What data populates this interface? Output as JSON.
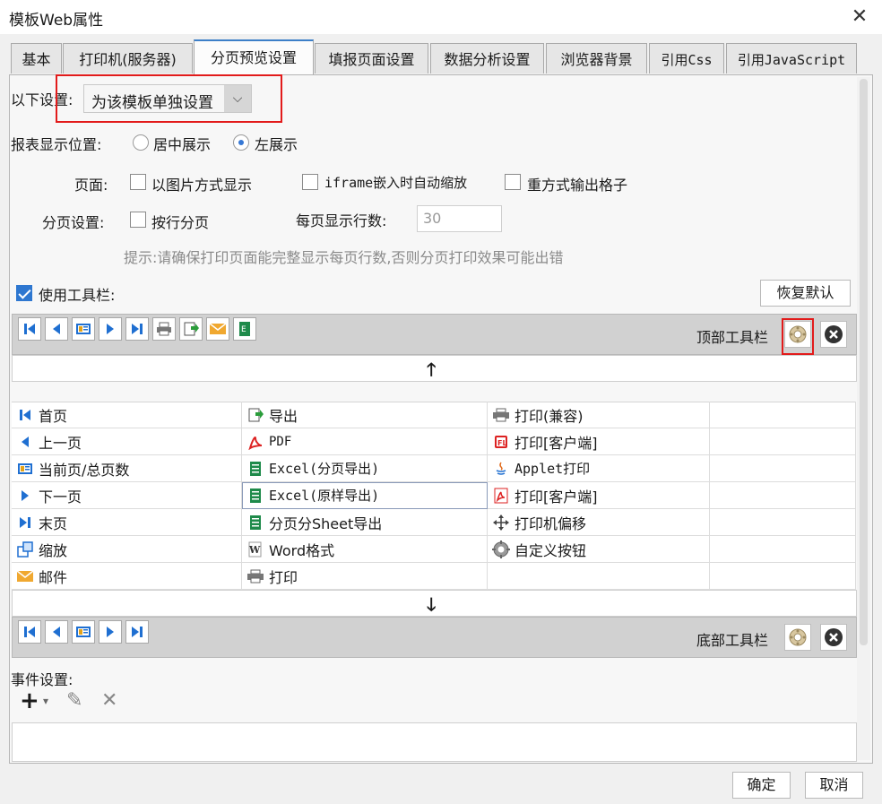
{
  "window": {
    "title": "模板Web属性",
    "close_glyph": "✕"
  },
  "tabs": [
    {
      "label": "基本",
      "active": false
    },
    {
      "label": "打印机(服务器)",
      "active": false
    },
    {
      "label": "分页预览设置",
      "active": true
    },
    {
      "label": "填报页面设置",
      "active": false
    },
    {
      "label": "数据分析设置",
      "active": false
    },
    {
      "label": "浏览器背景",
      "active": false
    },
    {
      "label": "引用Css",
      "active": false
    },
    {
      "label": "引用JavaScript",
      "active": false
    }
  ],
  "settings": {
    "label": "以下设置:",
    "value": "为该模板单独设置",
    "arrow_glyph": "⌵"
  },
  "position": {
    "label": "报表显示位置:",
    "options": [
      {
        "label": "居中展示",
        "selected": false
      },
      {
        "label": "左展示",
        "selected": true
      }
    ]
  },
  "page": {
    "label": "页面:",
    "options": [
      {
        "label": "以图片方式显示",
        "checked": false
      },
      {
        "label": "iframe嵌入时自动缩放",
        "checked": false
      },
      {
        "label": "重方式输出格子",
        "checked": false
      }
    ]
  },
  "pagination": {
    "label": "分页设置:",
    "by_row_label": "按行分页",
    "by_row_checked": false,
    "rows_label": "每页显示行数:",
    "rows_value": "30",
    "hint": "提示:请确保打印页面能完整显示每页行数,否则分页打印效果可能出错"
  },
  "toolbar": {
    "use_label": "使用工具栏:",
    "use_checked": true,
    "restore_label": "恢复默认",
    "top_label": "顶部工具栏",
    "bottom_label": "底部工具栏",
    "up_arrow": "🡑",
    "down_arrow": "🡓"
  },
  "grid": {
    "col1": [
      {
        "icon": "first-page-icon",
        "label": "首页"
      },
      {
        "icon": "previous-page-icon",
        "label": "上一页"
      },
      {
        "icon": "page-count-icon",
        "label": "当前页/总页数"
      },
      {
        "icon": "next-page-icon",
        "label": "下一页"
      },
      {
        "icon": "last-page-icon",
        "label": "末页"
      },
      {
        "icon": "zoom-icon",
        "label": "缩放"
      },
      {
        "icon": "email-icon",
        "label": "邮件"
      }
    ],
    "col2": [
      {
        "icon": "export-icon",
        "label": "导出"
      },
      {
        "icon": "pdf-icon",
        "label": "PDF"
      },
      {
        "icon": "excel-icon",
        "label": "Excel(分页导出)"
      },
      {
        "icon": "excel-icon",
        "label": "Excel(原样导出)"
      },
      {
        "icon": "excel-icon",
        "label": "分页分Sheet导出"
      },
      {
        "icon": "word-icon",
        "label": "Word格式"
      },
      {
        "icon": "printer-icon",
        "label": "打印"
      }
    ],
    "col3": [
      {
        "icon": "printer-icon",
        "label": "打印(兼容)"
      },
      {
        "icon": "flash-print-icon",
        "label": "打印[客户端]"
      },
      {
        "icon": "java-icon",
        "label": "Applet打印"
      },
      {
        "icon": "pdf-print-icon",
        "label": "打印[客户端]"
      },
      {
        "icon": "move-icon",
        "label": "打印机偏移"
      },
      {
        "icon": "gear-icon",
        "label": "自定义按钮"
      },
      {
        "icon": "",
        "label": ""
      }
    ]
  },
  "events": {
    "label": "事件设置:",
    "add_glyph": "+",
    "add_dropdown_glyph": "▾",
    "edit_glyph": "✎",
    "delete_glyph": "✕"
  },
  "footer": {
    "ok_label": "确定",
    "cancel_label": "取消"
  },
  "colors": {
    "accent": "#2e77d0",
    "highlight_red": "#e21b1b",
    "toolbar_gray": "#d1d1d1",
    "icon_blue": "#1f6fd1",
    "excel_green": "#1e8a4a",
    "pdf_red": "#d22"
  }
}
